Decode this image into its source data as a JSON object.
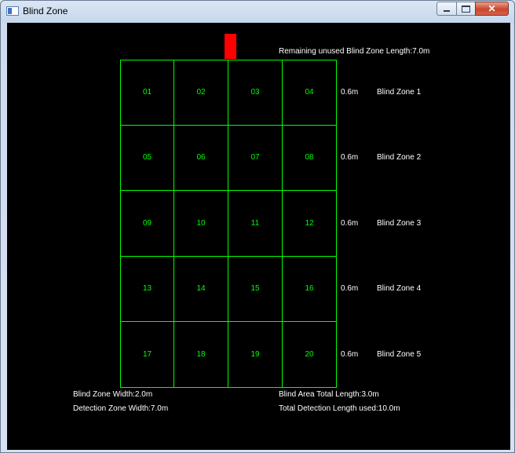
{
  "window": {
    "title": "Blind Zone"
  },
  "remaining_label": "Remaining unused Blind Zone Length:7.0m",
  "cells": [
    "01",
    "02",
    "03",
    "04",
    "05",
    "06",
    "07",
    "08",
    "09",
    "10",
    "11",
    "12",
    "13",
    "14",
    "15",
    "16",
    "17",
    "18",
    "19",
    "20"
  ],
  "rows": [
    {
      "length": "0.6m",
      "label": "Blind Zone 1"
    },
    {
      "length": "0.6m",
      "label": "Blind Zone 2"
    },
    {
      "length": "0.6m",
      "label": "Blind Zone 3"
    },
    {
      "length": "0.6m",
      "label": "Blind Zone 4"
    },
    {
      "length": "0.6m",
      "label": "Blind Zone 5"
    }
  ],
  "info": {
    "blind_zone_width": "Blind Zone Width:2.0m",
    "detection_zone_width": "Detection Zone Width:7.0m",
    "blind_area_total_length": "Blind Area Total Length:3.0m",
    "total_detection_length_used": "Total Detection Length used:10.0m"
  },
  "colors": {
    "grid": "#00ff00",
    "marker": "#ff0000",
    "background": "#000000",
    "text": "#ffffff"
  },
  "icons": {
    "app": "app-window-icon",
    "minimize": "minimize-icon",
    "maximize": "maximize-icon",
    "close": "close-icon"
  }
}
